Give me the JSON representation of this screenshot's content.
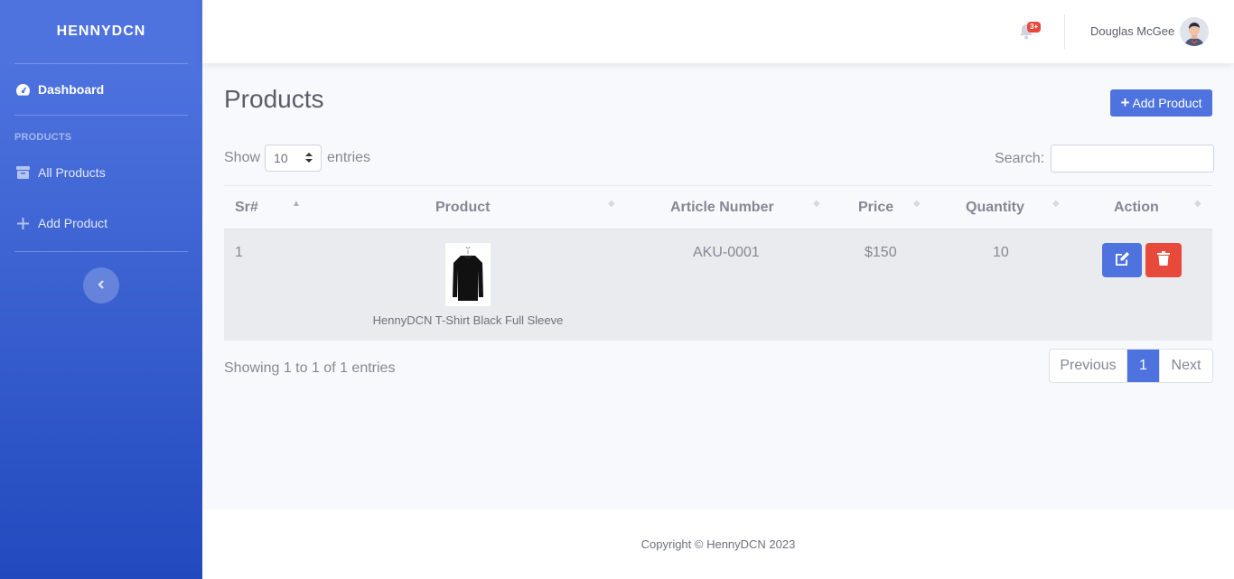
{
  "brand": "HENNYDCN",
  "sidebar": {
    "dashboard": "Dashboard",
    "heading": "PRODUCTS",
    "items": [
      {
        "label": "All Products",
        "icon": "box-icon"
      },
      {
        "label": "Add Product",
        "icon": "plus-icon"
      }
    ]
  },
  "topbar": {
    "alerts_badge": "3+",
    "user_name": "Douglas McGee"
  },
  "page": {
    "title": "Products",
    "add_button": "Add Product"
  },
  "table_controls": {
    "show_label": "Show",
    "entries_value": "10",
    "entries_label": "entries",
    "search_label": "Search:"
  },
  "table": {
    "columns": [
      "Sr#",
      "Product",
      "Article Number",
      "Price",
      "Quantity",
      "Action"
    ],
    "rows": [
      {
        "sr": "1",
        "product": "HennyDCN T-Shirt Black Full Sleeve",
        "article": "AKU-0001",
        "price": "$150",
        "quantity": "10"
      }
    ]
  },
  "footer_info": "Showing 1 to 1 of 1 entries",
  "pagination": {
    "previous": "Previous",
    "page": "1",
    "next": "Next"
  },
  "copyright": "Copyright © HennyDCN 2023",
  "colors": {
    "primary": "#4e73df",
    "danger": "#e74a3b"
  }
}
